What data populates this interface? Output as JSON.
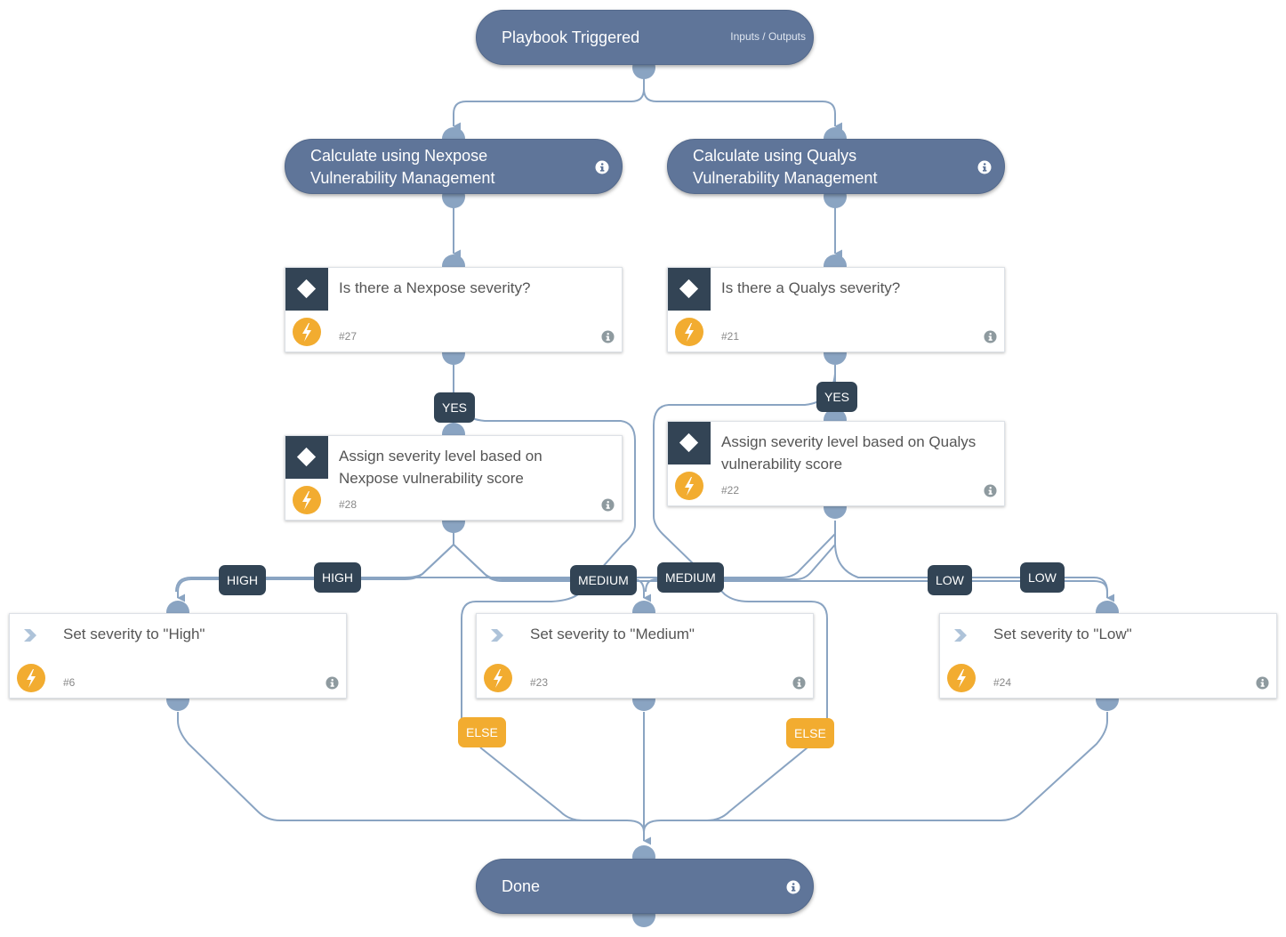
{
  "colors": {
    "pill": "#5f7599",
    "edge": "#8aa4c2",
    "label_dark": "#324455",
    "else_label": "#f2ac30",
    "bolt": "#f2ac30"
  },
  "start": {
    "title": "Playbook Triggered",
    "link": "Inputs / Outputs"
  },
  "end": {
    "title": "Done",
    "icon": "info-icon"
  },
  "subplaybooks": [
    {
      "line1": "Calculate using Nexpose",
      "line2": "Vulnerability Management",
      "icon": "info-icon"
    },
    {
      "line1": "Calculate using Qualys",
      "line2": "Vulnerability Management",
      "icon": "info-icon"
    }
  ],
  "tasks": {
    "nexpose_check": {
      "title": "Is there a Nexpose severity?",
      "id": "#27",
      "type": "condition"
    },
    "qualys_check": {
      "title": "Is there a Qualys severity?",
      "id": "#21",
      "type": "condition"
    },
    "nexpose_assign": {
      "title": "Assign severity level based on Nexpose vulnerability score",
      "id": "#28",
      "type": "condition"
    },
    "qualys_assign": {
      "title": "Assign severity level based on Qualys vulnerability score",
      "id": "#22",
      "type": "condition"
    },
    "set_high": {
      "title": "Set severity to \"High\"",
      "id": "#6",
      "type": "action"
    },
    "set_medium": {
      "title": "Set severity to \"Medium\"",
      "id": "#23",
      "type": "action"
    },
    "set_low": {
      "title": "Set severity to \"Low\"",
      "id": "#24",
      "type": "action"
    }
  },
  "edge_labels": {
    "yes": "YES",
    "high": "HIGH",
    "medium": "MEDIUM",
    "low": "LOW",
    "else": "ELSE"
  }
}
